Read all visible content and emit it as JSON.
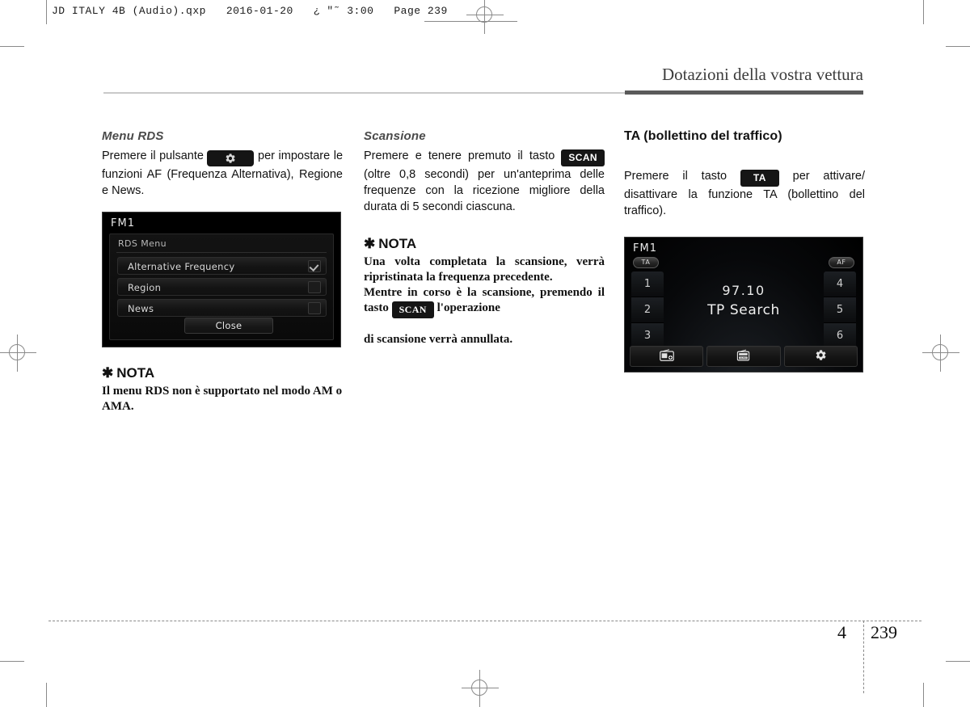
{
  "print_marks": {
    "slug": "JD ITALY 4B (Audio).qxp   2016-01-20   ¿ \"˜ 3:00   Page 239"
  },
  "header": {
    "chapter_title": "Dotazioni della vostra vettura"
  },
  "columns": {
    "left": {
      "sub_head": "Menu RDS",
      "paragraph_before_icon": "Premere il pulsante",
      "icon_button": "gear-icon",
      "paragraph_after_icon": "per impostare le funzioni AF (Frequenza Alternativa), Regione e News.",
      "note": {
        "asterisk": "✱",
        "title": "NOTA",
        "body": "Il menu RDS non è supportato nel modo AM o AMA."
      }
    },
    "middle": {
      "sub_head": "Scansione",
      "paragraph_before_key": "Premere e tenere premuto il tasto",
      "key_label": "SCAN",
      "paragraph_after_key": "(oltre 0,8 secondi) per un'anteprima delle frequenze con la ricezione migliore della durata di 5 secondi ciascuna.",
      "note": {
        "asterisk": "✱",
        "title": "NOTA",
        "line1": "Una volta completata la scansione, verrà ripristinata la frequenza precedente.",
        "line2_before_key": "Mentre in corso è la scansione, premendo il tasto",
        "key_label": "SCAN",
        "line2_after_key": "l'operazione",
        "line3": "di scansione verrà annullata."
      }
    },
    "right": {
      "sec_head": "TA (bollettino del traffico)",
      "paragraph_before_key": "Premere il tasto",
      "key_label": "TA",
      "paragraph_after_key": "per attivare/ disattivare la funzione TA (bollettino del traffico)."
    }
  },
  "screen_rds": {
    "source_label": "FM1",
    "panel_title": "RDS Menu",
    "rows": [
      {
        "label": "Alternative Frequency",
        "checked": true
      },
      {
        "label": "Region",
        "checked": false
      },
      {
        "label": "News",
        "checked": false
      }
    ],
    "close_button": "Close"
  },
  "screen_radio": {
    "source_label": "FM1",
    "badge_ta": "TA",
    "badge_af": "AF",
    "presets_left": [
      "1",
      "2",
      "3"
    ],
    "presets_right": [
      "4",
      "5",
      "6"
    ],
    "frequency": "97.10",
    "status_text": "TP Search",
    "toolbar": [
      {
        "icon": "radio-list-icon"
      },
      {
        "icon": "radio-auto-icon"
      },
      {
        "icon": "gear-icon"
      }
    ]
  },
  "footer": {
    "chapter_number": "4",
    "page_number": "239"
  }
}
